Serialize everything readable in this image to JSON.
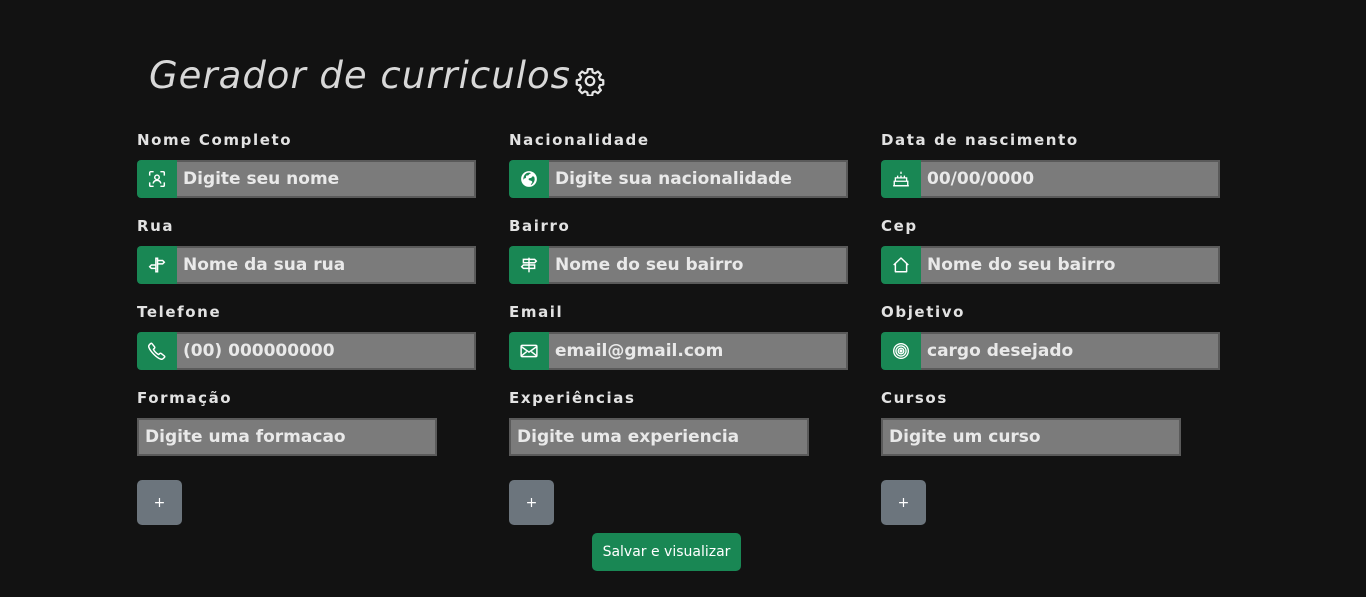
{
  "header": {
    "title": "Gerador de curriculos",
    "icon": "gear-icon"
  },
  "fields": {
    "nome": {
      "label": "Nome Completo",
      "placeholder": "Digite seu nome",
      "icon": "person-badge-icon"
    },
    "nacionalidade": {
      "label": "Nacionalidade",
      "placeholder": "Digite sua nacionalidade",
      "icon": "globe-icon"
    },
    "nascimento": {
      "label": "Data de nascimento",
      "placeholder": "00/00/0000",
      "icon": "cake-icon"
    },
    "rua": {
      "label": "Rua",
      "placeholder": "Nome da sua rua",
      "icon": "signpost-icon"
    },
    "bairro": {
      "label": "Bairro",
      "placeholder": "Nome do seu bairro",
      "icon": "signpost-split-icon"
    },
    "cep": {
      "label": "Cep",
      "placeholder": "Nome do seu bairro",
      "icon": "house-icon"
    },
    "telefone": {
      "label": "Telefone",
      "placeholder": "(00) 000000000",
      "icon": "phone-icon"
    },
    "email": {
      "label": "Email",
      "placeholder": "email@gmail.com",
      "icon": "envelope-icon"
    },
    "objetivo": {
      "label": "Objetivo",
      "placeholder": "cargo desejado",
      "icon": "target-icon"
    }
  },
  "lists": {
    "formacao": {
      "label": "Formação",
      "placeholder": "Digite uma formacao",
      "add_label": "+"
    },
    "experiencias": {
      "label": "Experiências",
      "placeholder": "Digite uma experiencia",
      "add_label": "+"
    },
    "cursos": {
      "label": "Cursos",
      "placeholder": "Digite um curso",
      "add_label": "+"
    }
  },
  "actions": {
    "save_label": "Salvar e visualizar"
  },
  "colors": {
    "accent": "#198754",
    "secondary": "#6c757d",
    "background": "#121212",
    "input_bg": "#7b7b7b"
  }
}
